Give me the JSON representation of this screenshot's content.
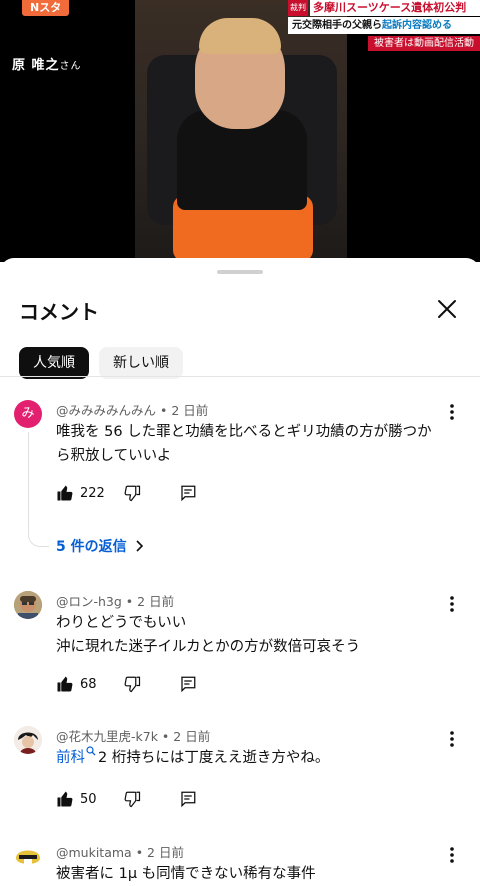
{
  "video": {
    "brand": "Nスタ",
    "person_name": "原 唯之",
    "person_suffix": "さん",
    "news_tag": "裁判",
    "headline_1": "多摩川スーツケース遺体初公判",
    "headline_2_pre": "元交際相手の父親ら",
    "headline_2_hl": "起訴内容認める",
    "headline_3": "被害者は動画配信活動"
  },
  "sheet": {
    "title": "コメント",
    "close_icon": "close-icon",
    "chips": [
      {
        "label": "人気順",
        "active": true
      },
      {
        "label": "新しい順",
        "active": false
      }
    ]
  },
  "comments": [
    {
      "author": "@みみみみんみん",
      "time": "2 日前",
      "avatar_letter": "み",
      "avatar_color": "#e2206f",
      "text_line1": "唯我を 56 した罪と功績を比べるとギリ功績の方が勝つか",
      "text_line2": "ら釈放していいよ",
      "likes": "222",
      "replies": "5 件の返信"
    },
    {
      "author": "@ロン-h3g",
      "time": "2 日前",
      "text_line1": "わりとどうでもいい",
      "text_line2": "沖に現れた迷子イルカとかの方が数倍可哀そう",
      "likes": "68"
    },
    {
      "author": "@花木九里虎-k7k",
      "time": "2 日前",
      "link_text": "前科",
      "text_line1": "2 桁持ちには丁度ええ逝き方やね。",
      "likes": "50"
    },
    {
      "author": "@mukitama",
      "time": "2 日前",
      "text_line1": "被害者に 1μ も同情できない稀有な事件"
    }
  ],
  "colors": {
    "link": "#065fd4",
    "news_red": "#c8102e",
    "brand_orange": "#f26b3a"
  }
}
